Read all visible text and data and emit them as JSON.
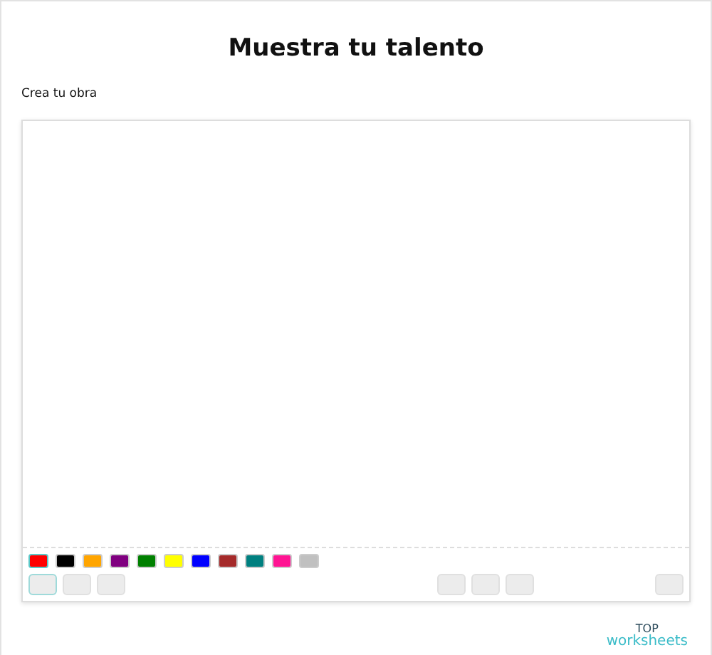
{
  "title": "Muestra tu talento",
  "prompt": "Crea tu obra",
  "palette": [
    {
      "color": "#ff0000",
      "selected": true
    },
    {
      "color": "#000000",
      "selected": false
    },
    {
      "color": "#ffa500",
      "selected": false
    },
    {
      "color": "#800080",
      "selected": false
    },
    {
      "color": "#008000",
      "selected": false
    },
    {
      "color": "#ffff00",
      "selected": false
    },
    {
      "color": "#0000ff",
      "selected": false
    },
    {
      "color": "#a52a2a",
      "selected": false
    },
    {
      "color": "#008080",
      "selected": false
    },
    {
      "color": "#ff1493",
      "selected": false
    },
    {
      "color": "#c0c0c0",
      "selected": false
    }
  ],
  "tool_groups": [
    [
      {
        "selected": true
      },
      {
        "selected": false
      },
      {
        "selected": false
      }
    ],
    [
      {
        "selected": false
      },
      {
        "selected": false
      },
      {
        "selected": false
      }
    ],
    [
      {
        "selected": false
      }
    ]
  ],
  "logo": {
    "top": "TOP",
    "bottom": "worksheets"
  }
}
